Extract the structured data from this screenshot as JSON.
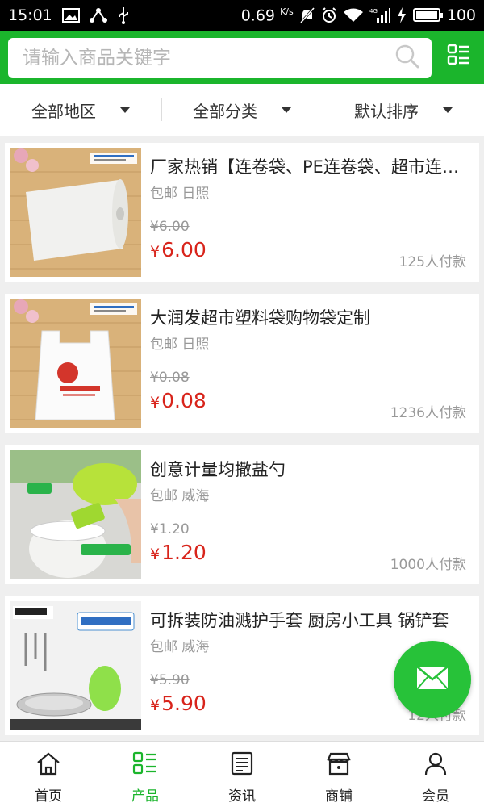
{
  "status_bar": {
    "time": "15:01",
    "net_speed": "0.69",
    "net_unit": "K/s",
    "signal_label": "4G",
    "battery": "100"
  },
  "header": {
    "search_placeholder": "请输入商品关键字"
  },
  "filters": [
    {
      "label": "全部地区"
    },
    {
      "label": "全部分类"
    },
    {
      "label": "默认排序"
    }
  ],
  "products": [
    {
      "title": "厂家热销【连卷袋、PE连卷袋、超市连卷袋",
      "shipping": "包邮",
      "city": "日照",
      "old_price": "¥6.00",
      "currency": "¥",
      "price": "6.00",
      "sold": "125人付款"
    },
    {
      "title": "大润发超市塑料袋购物袋定制",
      "shipping": "包邮",
      "city": "日照",
      "old_price": "¥0.08",
      "currency": "¥",
      "price": "0.08",
      "sold": "1236人付款"
    },
    {
      "title": "创意计量均撒盐勺",
      "shipping": "包邮",
      "city": "威海",
      "old_price": "¥1.20",
      "currency": "¥",
      "price": "1.20",
      "sold": "1000人付款"
    },
    {
      "title": "可拆装防油溅护手套 厨房小工具 锅铲套",
      "shipping": "包邮",
      "city": "威海",
      "old_price": "¥5.90",
      "currency": "¥",
      "price": "5.90",
      "sold": "12人付款"
    }
  ],
  "tabs": [
    {
      "label": "首页",
      "icon": "home-icon"
    },
    {
      "label": "产品",
      "icon": "grid-list-icon"
    },
    {
      "label": "资讯",
      "icon": "news-icon"
    },
    {
      "label": "商铺",
      "icon": "shop-icon"
    },
    {
      "label": "会员",
      "icon": "user-icon"
    }
  ],
  "colors": {
    "brand_green": "#1bb52c",
    "price_red": "#d8241b",
    "fab_green": "#27c239"
  }
}
